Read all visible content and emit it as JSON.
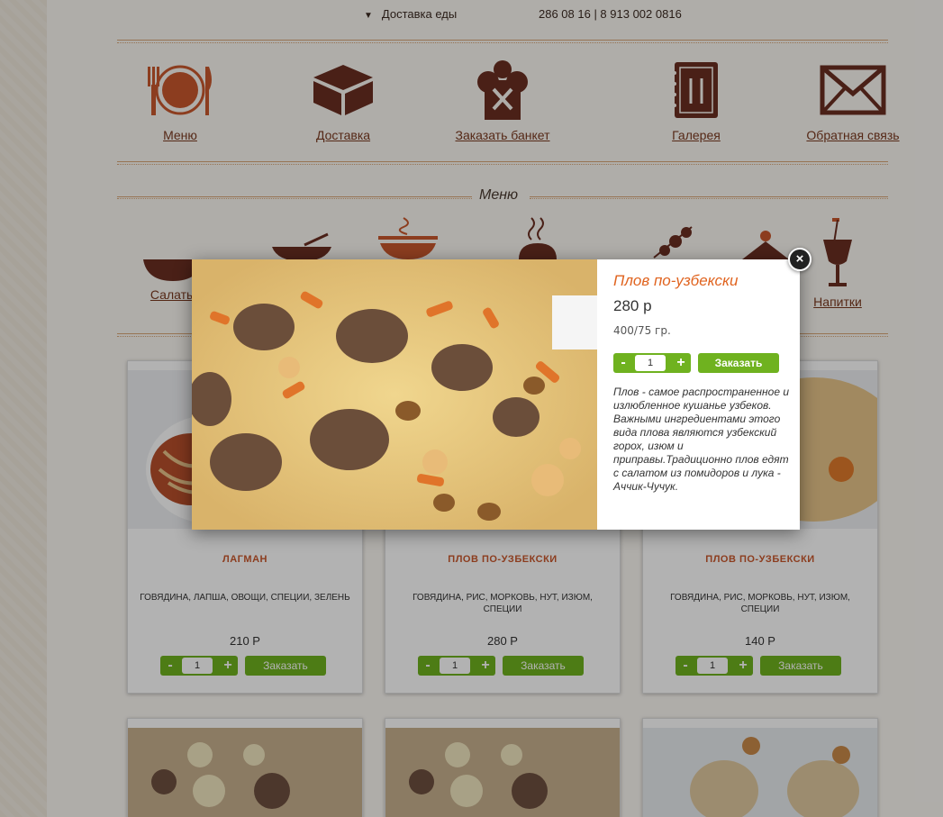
{
  "topbar": {
    "delivery": "Доставка еды",
    "phones": "286 08 16 | 8 913 002 0816"
  },
  "main_nav": [
    {
      "label": "Меню",
      "icon": "plate-cutlery-icon"
    },
    {
      "label": "Доставка",
      "icon": "box-icon"
    },
    {
      "label": "Заказать банкет",
      "icon": "chef-hat-icon"
    },
    {
      "label": "Галерея",
      "icon": "menu-book-icon"
    },
    {
      "label": "Обратная связь",
      "icon": "envelope-icon"
    }
  ],
  "menu_section": {
    "title": "Меню",
    "categories": [
      {
        "label": "Салаты",
        "icon": "bowl-icon"
      },
      {
        "label": "Напитки",
        "icon": "cocktail-icon"
      }
    ]
  },
  "products": [
    {
      "name": "ЛАГМАН",
      "desc": "ГОВЯДИНА, ЛАПША, ОВОЩИ, СПЕЦИИ, ЗЕЛЕНЬ",
      "price": "210 Р",
      "qty": "1",
      "order": "Заказать"
    },
    {
      "name": "ПЛОВ ПО-УЗБЕКСКИ",
      "desc": "ГОВЯДИНА, РИС, МОРКОВЬ, НУТ, ИЗЮМ, СПЕЦИИ",
      "price": "280 Р",
      "qty": "1",
      "order": "Заказать"
    },
    {
      "name": "ПЛОВ ПО-УЗБЕКСКИ",
      "desc": "ГОВЯДИНА, РИС, МОРКОВЬ, НУТ, ИЗЮМ, СПЕЦИИ",
      "price": "140 Р",
      "qty": "1",
      "order": "Заказать"
    }
  ],
  "modal": {
    "title": "Плов по-узбекски",
    "price": "280 р",
    "weight": "400/75 гр.",
    "qty": "1",
    "order": "Заказать",
    "description": "Плов - самое распространенное и излюбленное кушанье узбеков. Важными ингредиентами этого вида плова являются узбекский горох, изюм и приправы.Традиционно плов едят с салатом из помидоров и лука - Аччик-Чучук.",
    "close_icon": "close-icon"
  },
  "colors": {
    "accent": "#e06420",
    "brand_brown": "#7a3a20",
    "button_green": "#6fb21f"
  }
}
